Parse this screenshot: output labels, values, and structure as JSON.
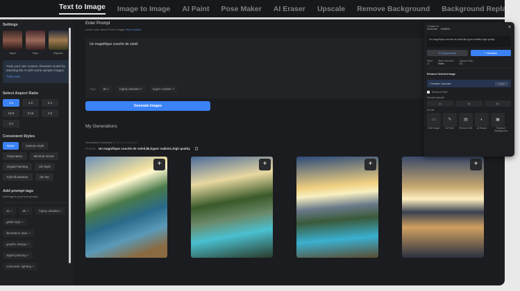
{
  "nav": {
    "tabs": [
      "Text to Image",
      "Image to Image",
      "AI Paint",
      "Pose Maker",
      "AI Eraser",
      "Upscale",
      "Remove Background",
      "Background Replacer"
    ],
    "active": 0
  },
  "sidebar": {
    "settings": "Settings",
    "characters": [
      "Naini",
      "Riya",
      "Rajveer"
    ],
    "train_text": "Train your own custom character model by teaching the AI with some sample images.",
    "train_link": "Train now",
    "aspect_title": "Select Aspect Ratio",
    "aspect": [
      "1:1",
      "3:2",
      "2:3",
      "16:9",
      "9:16",
      "4:3",
      "3:4"
    ],
    "styles_title": "Consistent Styles",
    "styles": [
      "None",
      "Cartoon style",
      "Claymation",
      "Minimal Vector",
      "Digital Painting",
      "3D Style",
      "Kids Illustration",
      "Jim lee"
    ],
    "tags_title": "Add prompt tags",
    "tags_sub": "Add tags to your text prompt.",
    "tags": [
      "4k +",
      "8k +",
      "highly detailed +",
      "ghibli style +",
      "illustration style +",
      "graphic design +",
      "digital painting +",
      "volumetric lighting +"
    ]
  },
  "main": {
    "title": "Enter Prompt",
    "sub": "Learn more about Text to Image",
    "sub_link": "How it works",
    "prompt": "Un magnifique couché de soleil",
    "tags_label": "Tags",
    "prompt_tags": [
      "8k ×",
      "highly detailed ×",
      "hyper realistic ×"
    ],
    "generate": "Generate Images",
    "gens_title": "My Generations",
    "status": "Generation Complete",
    "status_meta": "10:03 am | 13/06/24",
    "prompt_label": "Prompt:",
    "prompt_full": "Un magnifique couché de soleil,8k,hyper realistic,high quality",
    "plus": "+"
  },
  "panel": {
    "created_label": "Created on",
    "time": "10:03 am",
    "date": "13/06/24",
    "prompt": "Un magnifique couché de soleil,8k,hyper realistic,high quality",
    "regenerate": "↻ Regenerate",
    "variation": "+ Variation",
    "seed_label": "Seed",
    "seed": "-1",
    "style_label": "Style Selected",
    "style": "None",
    "ratio_label": "Aspect Ratio",
    "ratio": "1:1",
    "enhance": "Enhance Selected Image",
    "creative": "Creative Upscale",
    "apply": "Apply",
    "face": "Enhance Face",
    "normal": "Normal Upscale",
    "ups": [
      "2x",
      "4x",
      "8x"
    ],
    "ai_edit": "AI Edit",
    "edits": [
      "Edit Image",
      "AI Paint",
      "Remove BG",
      "AI Eraser",
      "Replace Background"
    ],
    "close": "×"
  }
}
